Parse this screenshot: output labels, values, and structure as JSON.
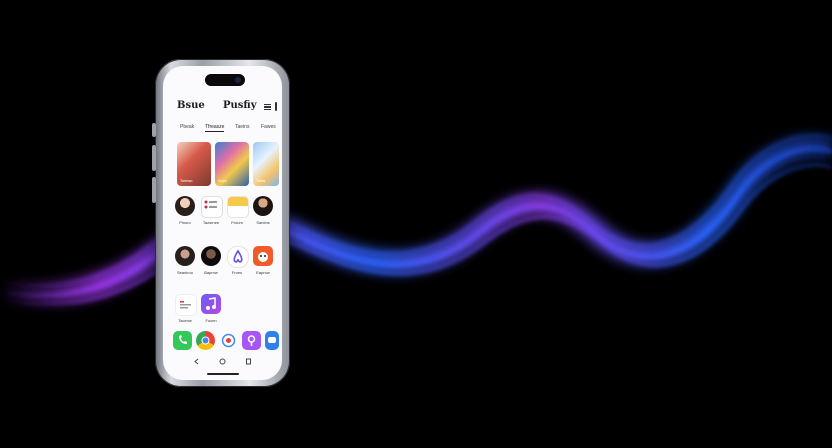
{
  "header": {
    "title_left": "Bsue",
    "title_right": "Pusfiy"
  },
  "tabs": [
    {
      "label": "Pbeak",
      "active": false
    },
    {
      "label": "Tfreasze",
      "active": true
    },
    {
      "label": "Taeins",
      "active": false
    },
    {
      "label": "Fawes",
      "active": false
    }
  ],
  "cards": [
    {
      "label": "Toiewo"
    },
    {
      "label": "Alqsl"
    },
    {
      "label": "Toiss"
    }
  ],
  "icon_rows": [
    [
      {
        "label": "Pinoro",
        "icon": "avatar-icon"
      },
      {
        "label": "Tazsrnee",
        "icon": "list-icon"
      },
      {
        "label": "Froum",
        "icon": "notes-icon"
      },
      {
        "label": "Sarcins",
        "icon": "avatar-icon"
      }
    ],
    [
      {
        "label": "Seaniroo",
        "icon": "avatar-icon"
      },
      {
        "label": "Baprnw",
        "icon": "avatar-icon"
      },
      {
        "label": "Froes",
        "icon": "airbnb-icon"
      },
      {
        "label": "Eaprow",
        "icon": "mascot-icon"
      }
    ],
    [
      {
        "label": "Tacenw",
        "icon": "text-widget-icon"
      },
      {
        "label": "Fucnn",
        "icon": "music-icon"
      }
    ]
  ],
  "dock": [
    {
      "icon": "phone-icon",
      "color": "#34c759"
    },
    {
      "icon": "chrome-icon",
      "color": "#ea4335"
    },
    {
      "icon": "target-icon",
      "color": "#4285f4"
    },
    {
      "icon": "podcast-icon",
      "color": "#a855f7"
    },
    {
      "icon": "messages-icon",
      "color": "#2f80ed"
    }
  ],
  "colors": {
    "background": "#000000",
    "wave_purple": "#a23cf0",
    "wave_blue": "#2f6bff",
    "phone_frame": "#c9ccd2",
    "screen": "#fbfbfd"
  }
}
